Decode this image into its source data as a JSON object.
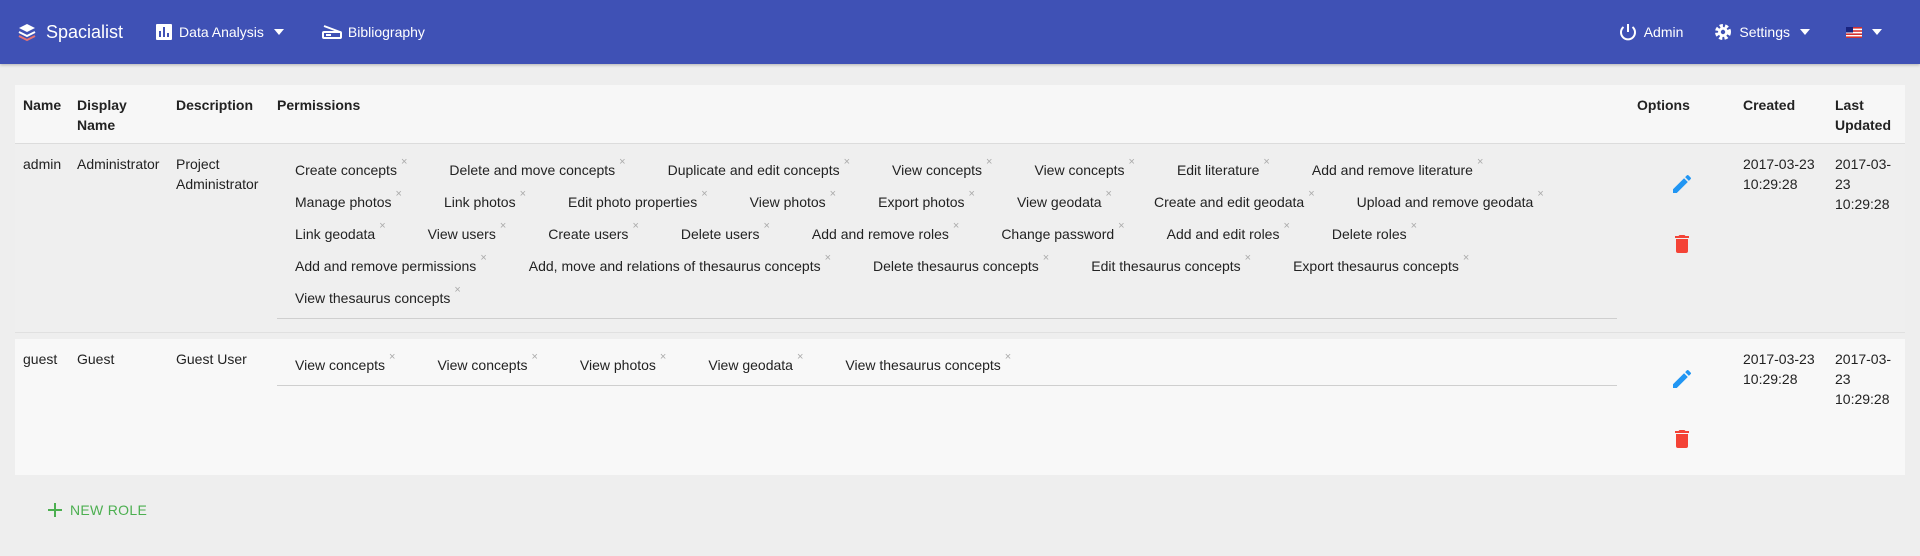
{
  "nav": {
    "brand": "Spacialist",
    "data_analysis": "Data Analysis",
    "bibliography": "Bibliography",
    "admin": "Admin",
    "settings": "Settings"
  },
  "table": {
    "headers": {
      "name": "Name",
      "display_name": "Display Name",
      "description": "Description",
      "permissions": "Permissions",
      "options": "Options",
      "created": "Created",
      "last_updated": "Last Updated"
    },
    "rows": [
      {
        "name": "admin",
        "display_name": "Administrator",
        "description": "Project Administrator",
        "permissions": [
          "Create concepts",
          "Delete and move concepts",
          "Duplicate and edit concepts",
          "View concepts",
          "View concepts",
          "Edit literature",
          "Add and remove literature",
          "Manage photos",
          "Link photos",
          "Edit photo properties",
          "View photos",
          "Export photos",
          "View geodata",
          "Create and edit geodata",
          "Upload and remove geodata",
          "Link geodata",
          "View users",
          "Create users",
          "Delete users",
          "Add and remove roles",
          "Change password",
          "Add and edit roles",
          "Delete roles",
          "Add and remove permissions",
          "Add, move and relations of thesaurus concepts",
          "Delete thesaurus concepts",
          "Edit thesaurus concepts",
          "Export thesaurus concepts",
          "View thesaurus concepts"
        ],
        "created": "2017-03-23 10:29:28",
        "updated": "2017-03-23 10:29:28"
      },
      {
        "name": "guest",
        "display_name": "Guest",
        "description": "Guest User",
        "permissions": [
          "View concepts",
          "View concepts",
          "View photos",
          "View geodata",
          "View thesaurus concepts"
        ],
        "created": "2017-03-23 10:29:28",
        "updated": "2017-03-23 10:29:28"
      }
    ]
  },
  "tag_remove_glyph": "×",
  "new_role_label": "NEW ROLE",
  "colors": {
    "navbar": "#3f51b5",
    "edit_icon": "#2196f3",
    "delete_icon": "#f44336",
    "new_role": "#4caf50"
  },
  "icons": {
    "brand": "spacialist-logo-icon",
    "data_analysis": "bar-chart-icon",
    "bibliography": "scanner-icon",
    "admin": "power-icon",
    "settings": "gear-icon",
    "language": "us-flag-icon",
    "edit": "pencil-icon",
    "delete": "trash-icon",
    "new_role": "plus-icon"
  }
}
